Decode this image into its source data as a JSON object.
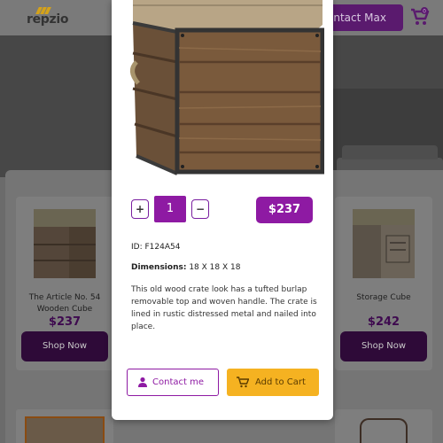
{
  "header": {
    "logo_text": "repzio",
    "contact_label": "ontact Max",
    "cart_badge": "0"
  },
  "listing": {
    "cards": [
      {
        "name": "The Article No. 54 Wooden Cube",
        "price": "$237",
        "button": "Shop Now"
      },
      {
        "name": "Storage Cube",
        "price": "$242",
        "button": "Shop Now"
      }
    ]
  },
  "modal": {
    "quantity": "1",
    "plus_label": "+",
    "minus_label": "−",
    "price": "$237",
    "id_label": "ID:",
    "id_value": "F124A54",
    "dimensions_label": "Dimensions:",
    "dimensions_value": "18 X 18 X 18",
    "description": "This old wood crate look has a tufted burlap removable top and woven handle. The crate is lined in rustic distressed metal and nailed into place.",
    "contact_button": "Contact me",
    "add_to_cart_button": "Add to Cart"
  },
  "colors": {
    "accent_purple": "#8e1aa3",
    "add_to_cart_yellow": "#f5b221"
  }
}
